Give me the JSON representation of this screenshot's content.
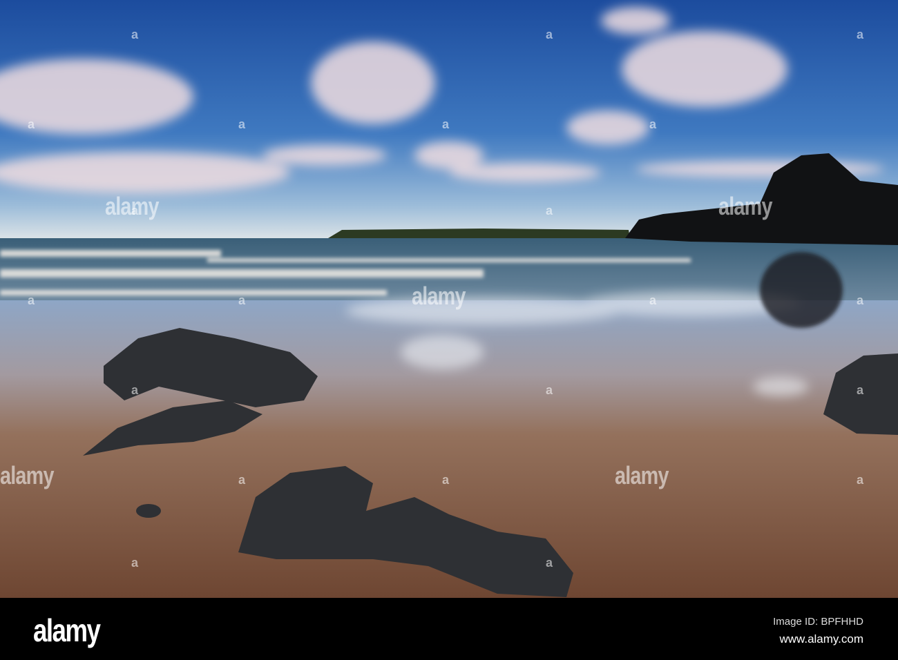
{
  "watermark": {
    "text": "alamy",
    "small_mark": "a"
  },
  "footer": {
    "logo": "alamy",
    "image_id": "Image ID: BPFHHD",
    "url": "www.alamy.com"
  },
  "colors": {
    "sky_top": "#1c4c9e",
    "sky_horizon": "#cfdbe6",
    "sand": "#7a5440",
    "rock": "#2e3034"
  }
}
